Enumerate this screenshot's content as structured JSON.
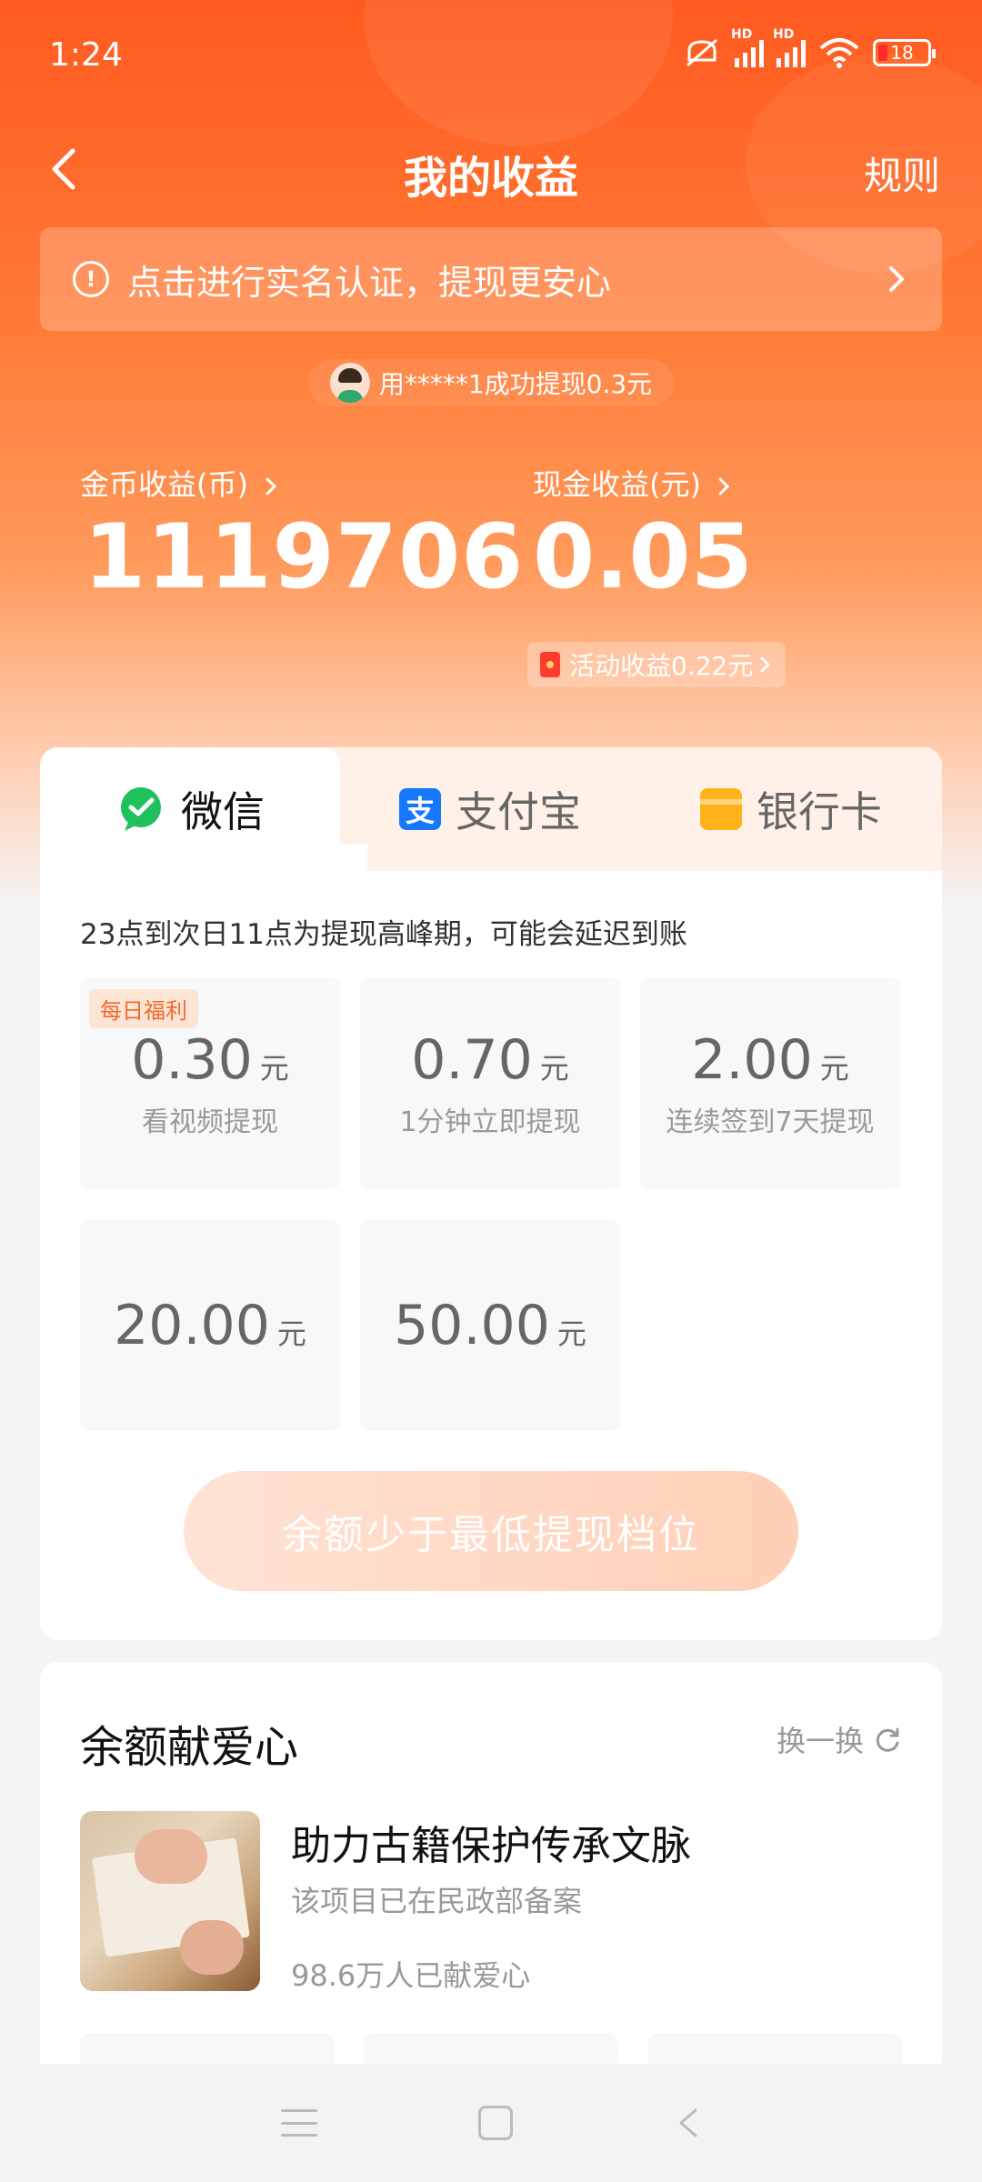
{
  "status": {
    "time": "1:24",
    "battery": "18"
  },
  "header": {
    "title": "我的收益",
    "rules": "规则"
  },
  "verify_banner": {
    "text": "点击进行实名认证，提现更安心"
  },
  "ticker": {
    "text": "用*****1成功提现0.3元"
  },
  "earnings": {
    "coin_label": "金币收益(币)",
    "coin_value": "1119706",
    "cash_label": "现金收益(元)",
    "cash_value": "0.05",
    "activity": "活动收益0.22元"
  },
  "tabs": [
    {
      "label": "微信",
      "icon": "wechat-icon"
    },
    {
      "label": "支付宝",
      "icon": "alipay-icon"
    },
    {
      "label": "银行卡",
      "icon": "bank-card-icon"
    }
  ],
  "withdraw": {
    "peak_note": "23点到次日11点为提现高峰期，可能会延迟到账",
    "daily_badge": "每日福利",
    "unit": "元",
    "options": [
      {
        "amount": "0.30",
        "desc": "看视频提现"
      },
      {
        "amount": "0.70",
        "desc": "1分钟立即提现"
      },
      {
        "amount": "2.00",
        "desc": "连续签到7天提现"
      },
      {
        "amount": "20.00",
        "desc": ""
      },
      {
        "amount": "50.00",
        "desc": ""
      }
    ],
    "button": "余额少于最低提现档位"
  },
  "donate": {
    "title": "余额献爱心",
    "refresh": "换一换",
    "project_title": "助力古籍保护传承文脉",
    "project_sub": "该项目已在民政部备案",
    "project_count": "98.6万人已献爱心"
  },
  "colors": {
    "accent": "#ff5a1f",
    "wechat": "#20c05c",
    "alipay": "#1677ff",
    "card": "#ffb21a"
  }
}
